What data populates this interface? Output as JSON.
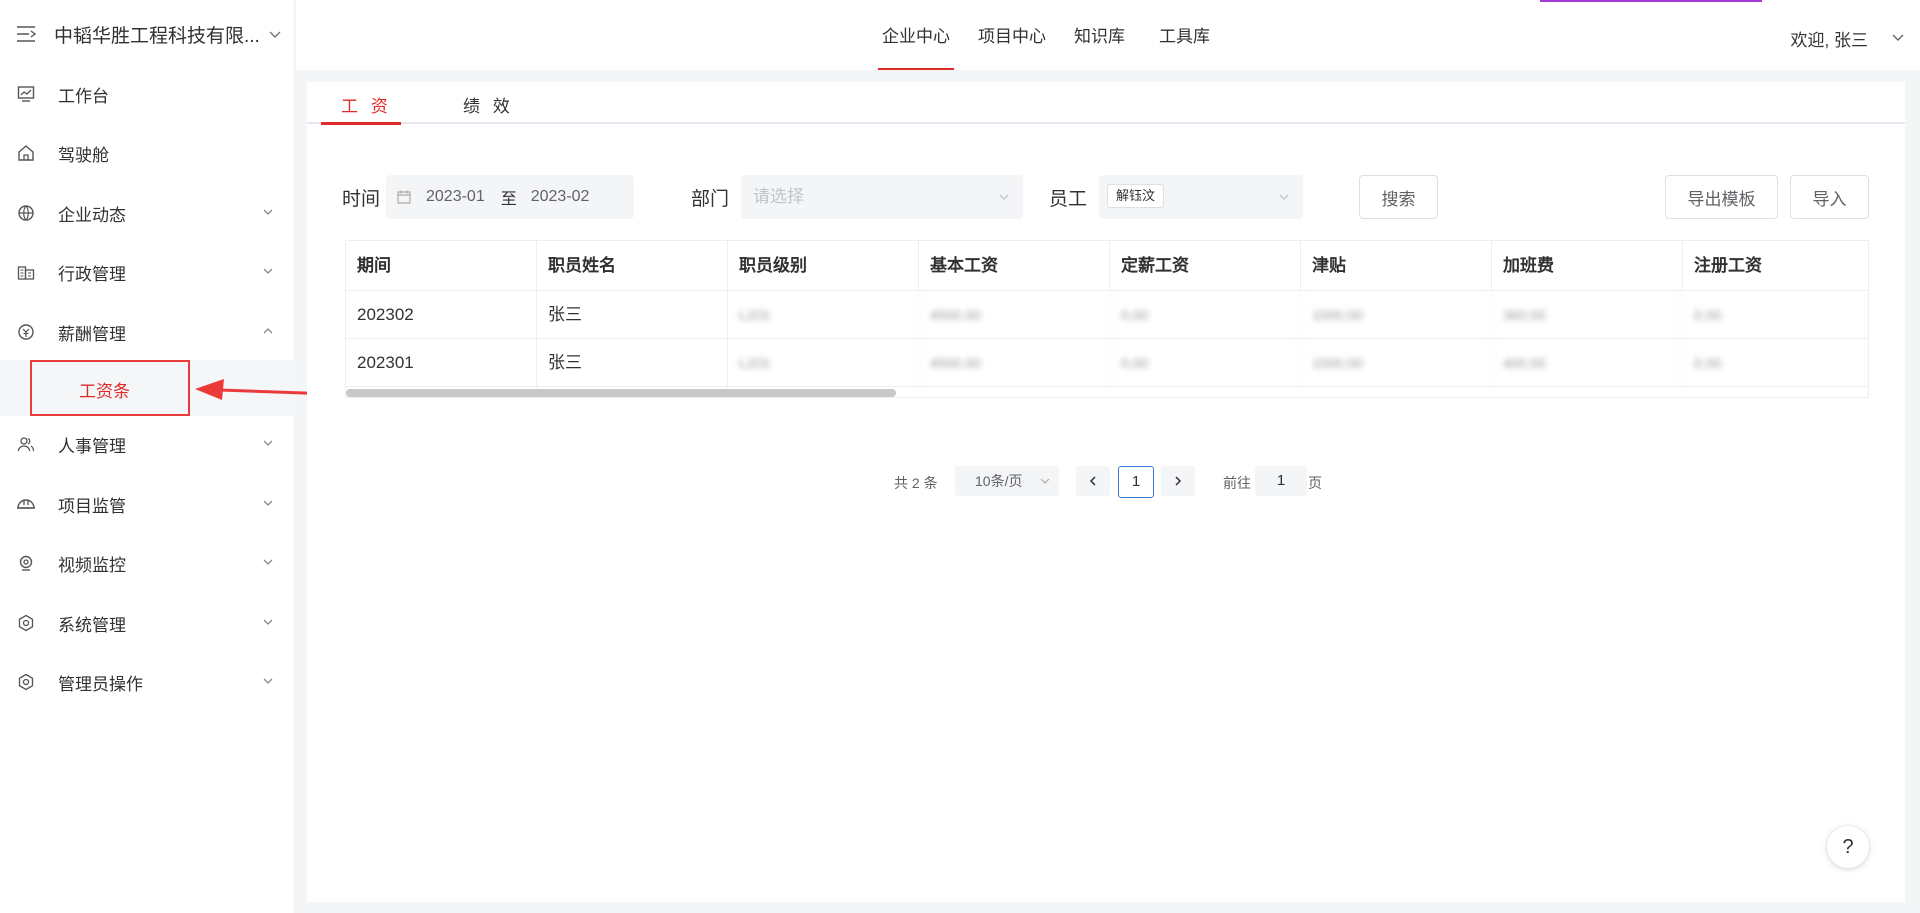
{
  "sidebar": {
    "org_name": "中韬华胜工程科技有限...",
    "items": [
      {
        "label": "工作台",
        "icon": "dashboard-icon"
      },
      {
        "label": "驾驶舱",
        "icon": "home-icon"
      },
      {
        "label": "企业动态",
        "icon": "globe-icon"
      },
      {
        "label": "行政管理",
        "icon": "building-icon"
      },
      {
        "label": "薪酬管理",
        "icon": "salary-icon"
      },
      {
        "label": "人事管理",
        "icon": "people-icon"
      },
      {
        "label": "项目监管",
        "icon": "helmet-icon"
      },
      {
        "label": "视频监控",
        "icon": "camera-icon"
      },
      {
        "label": "系统管理",
        "icon": "settings-icon"
      },
      {
        "label": "管理员操作",
        "icon": "admin-icon"
      }
    ],
    "sub_item": "工资条"
  },
  "topbar": {
    "nav": [
      "企业中心",
      "项目中心",
      "知识库",
      "工具库"
    ],
    "active_nav": "企业中心",
    "welcome": "欢迎, 张三"
  },
  "tabs": [
    "工 资",
    "绩 效"
  ],
  "filters": {
    "time_label": "时间",
    "date_start": "2023-01",
    "date_sep": "至",
    "date_end": "2023-02",
    "dept_label": "部门",
    "dept_placeholder": "请选择",
    "employee_label": "员工",
    "employee_tag": "解钰汶",
    "search_button": "搜索",
    "export_button": "导出模板",
    "import_button": "导入"
  },
  "table": {
    "headers": [
      "期间",
      "职员姓名",
      "职员级别",
      "基本工资",
      "定薪工资",
      "津贴",
      "加班费",
      "注册工资"
    ],
    "rows": [
      [
        "202302",
        "张三",
        "L2OI",
        "4500.00",
        "0.00",
        "1000.00",
        "360.00",
        "0.00"
      ],
      [
        "202301",
        "张三",
        "L2OI",
        "4500.00",
        "0.00",
        "1500.00",
        "400.00",
        "0.00"
      ]
    ]
  },
  "pager": {
    "total": "共 2 条",
    "page_size": "10条/页",
    "current": "1",
    "goto_label": "前往",
    "goto_value": "1",
    "page_unit": "页"
  },
  "help": "?",
  "colors": {
    "accent": "#e02a2a",
    "topbar_accent": "#a23bd6"
  }
}
